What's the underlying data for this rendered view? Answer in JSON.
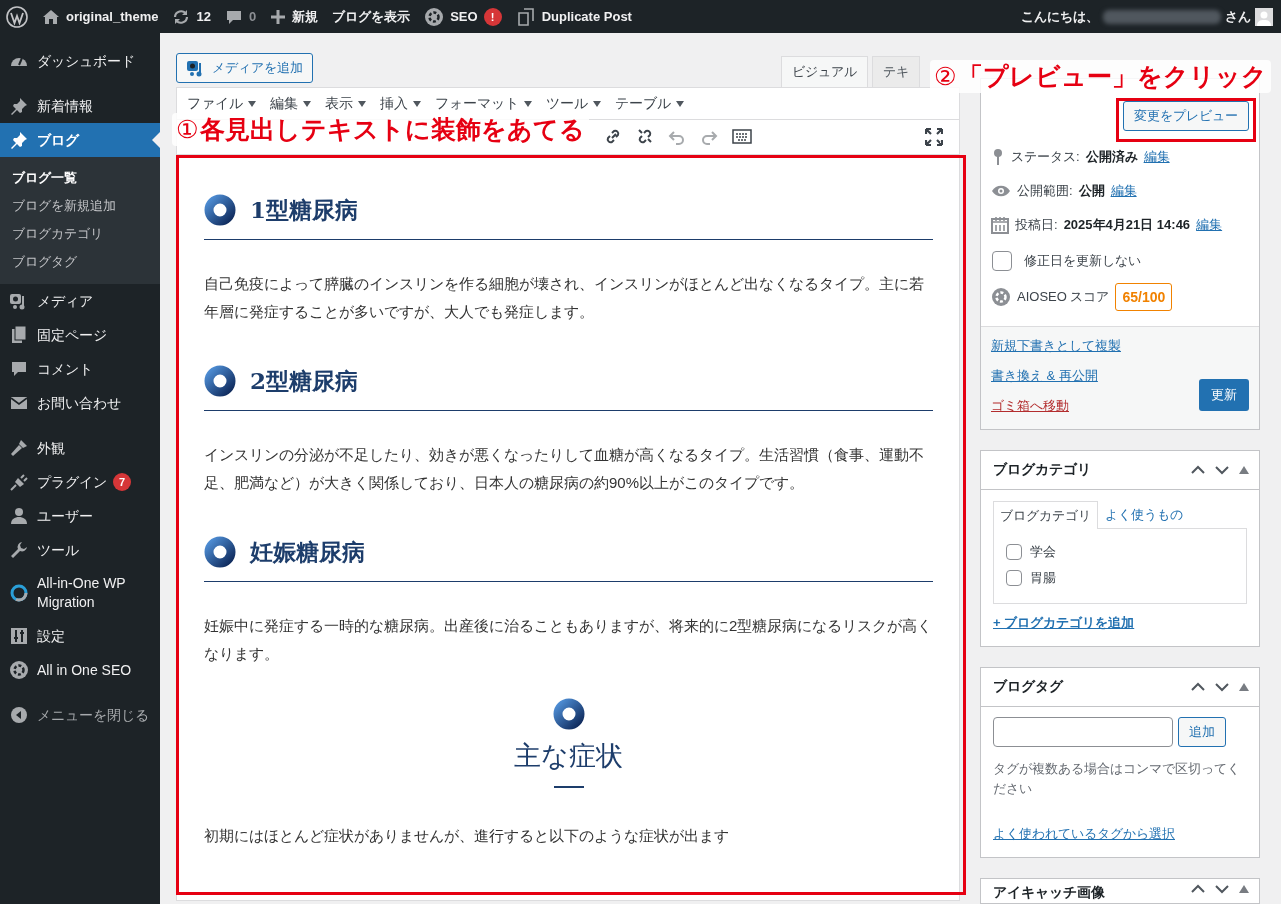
{
  "admin_bar": {
    "site": "original_theme",
    "updates": "12",
    "comments": "0",
    "new": "新規",
    "view": "ブログを表示",
    "seo": "SEO",
    "seo_badge": "!",
    "duplicate": "Duplicate Post",
    "greeting": "こんにちは、",
    "greeting_suffix": "さん"
  },
  "sidebar": {
    "groups": [
      [
        {
          "label": "ダッシュボード",
          "selected": false
        }
      ],
      [
        {
          "label": "新着情報",
          "selected": false
        },
        {
          "label": "ブログ",
          "selected": true,
          "children": [
            {
              "label": "ブログ一覧",
              "selected": true
            },
            {
              "label": "ブログを新規追加",
              "selected": false
            },
            {
              "label": "ブログカテゴリ",
              "selected": false
            },
            {
              "label": "ブログタグ",
              "selected": false
            }
          ]
        },
        {
          "label": "メディア",
          "selected": false
        },
        {
          "label": "固定ページ",
          "selected": false
        },
        {
          "label": "コメント",
          "selected": false
        },
        {
          "label": "お問い合わせ",
          "selected": false
        }
      ],
      [
        {
          "label": "外観",
          "selected": false
        },
        {
          "label": "プラグイン",
          "selected": false,
          "badge": "7"
        },
        {
          "label": "ユーザー",
          "selected": false
        },
        {
          "label": "ツール",
          "selected": false
        },
        {
          "label": "All-in-One WP Migration",
          "selected": false
        },
        {
          "label": "設定",
          "selected": false
        },
        {
          "label": "All in One SEO",
          "selected": false
        }
      ]
    ],
    "collapse": "メニューを閉じる"
  },
  "editor": {
    "media_button": "メディアを追加",
    "tabs": [
      {
        "label": "ビジュアル",
        "selected": true
      },
      {
        "label": "テキ",
        "selected": false
      }
    ],
    "menu": [
      "ファイル",
      "編集",
      "表示",
      "挿入",
      "フォーマット",
      "ツール",
      "テーブル"
    ],
    "content": [
      {
        "kind": "heading",
        "text": "1型糖尿病"
      },
      {
        "kind": "paragraph",
        "text": "自己免疫によって膵臓のインスリンを作る細胞が壊され、インスリンがほとんど出なくなるタイプ。主に若年層に発症することが多いですが、大人でも発症します。"
      },
      {
        "kind": "heading",
        "text": "2型糖尿病"
      },
      {
        "kind": "paragraph",
        "text": "インスリンの分泌が不足したり、効きが悪くなったりして血糖が高くなるタイプ。生活習慣（食事、運動不足、肥満など）が大きく関係しており、日本人の糖尿病の約90%以上がこのタイプです。"
      },
      {
        "kind": "heading",
        "text": "妊娠糖尿病"
      },
      {
        "kind": "paragraph",
        "text": "妊娠中に発症する一時的な糖尿病。出産後に治ることもありますが、将来的に2型糖尿病になるリスクが高くなります。"
      },
      {
        "kind": "center_heading",
        "text": "主な症状"
      },
      {
        "kind": "paragraph",
        "text": "初期にはほとんど症状がありませんが、進行すると以下のような症状が出ます"
      }
    ]
  },
  "publish": {
    "preview_button": "変更をプレビュー",
    "rows": [
      {
        "label": "ステータス:",
        "value": "公開済み",
        "link": "編集"
      },
      {
        "label": "公開範囲:",
        "value": "公開",
        "link": "編集"
      },
      {
        "label": "投稿日:",
        "value": "2025年4月21日 14:46",
        "link": "編集"
      }
    ],
    "checkbox": {
      "label": "修正日を更新しない",
      "checked": false
    },
    "aioseo": {
      "label": "AIOSEO スコア",
      "score": "65/100"
    },
    "links": [
      "新規下書きとして複製",
      "書き換え & 再公開"
    ],
    "trash": "ゴミ箱へ移動",
    "update_button": "更新"
  },
  "category_box": {
    "title": "ブログカテゴリ",
    "tabs": [
      {
        "label": "ブログカテゴリ",
        "selected": true
      },
      {
        "label": "よく使うもの",
        "selected": false
      }
    ],
    "items": [
      {
        "label": "学会",
        "checked": false
      },
      {
        "label": "胃腸",
        "checked": false
      }
    ],
    "add_link": "+ ブログカテゴリを追加"
  },
  "tag_box": {
    "title": "ブログタグ",
    "add_button": "追加",
    "hint": "タグが複数ある場合はコンマで区切ってください",
    "link": "よく使われているタグから選択"
  },
  "featured_box": {
    "title": "アイキャッチ画像"
  },
  "annotations": [
    {
      "number": "①",
      "text": "各見出しテキストに装飾をあてる"
    },
    {
      "number": "②",
      "text": "「プレビュー」をクリック"
    }
  ]
}
